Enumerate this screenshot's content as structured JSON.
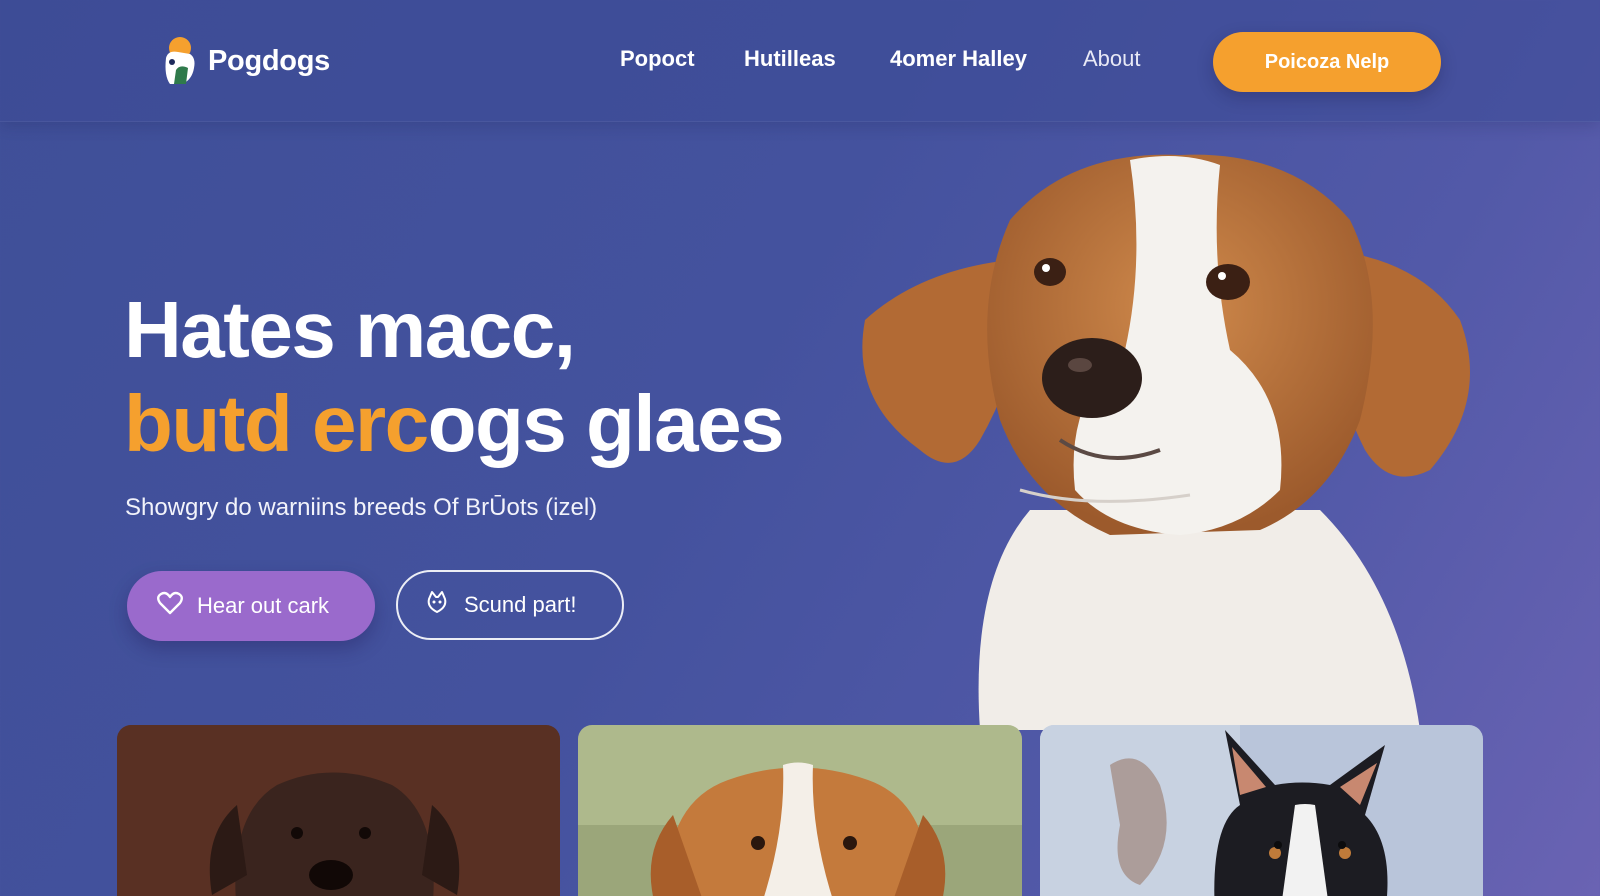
{
  "brand": {
    "name": "Pogdogs",
    "accent": "#f5a02e",
    "primary_button_color": "#9a6acc",
    "background": "#44529e"
  },
  "nav": {
    "items": [
      {
        "label": "Popoct"
      },
      {
        "label": "Hutilleas"
      },
      {
        "label": "4omer Halley"
      },
      {
        "label": "About"
      }
    ],
    "cta_label": "Poicoza Nelp"
  },
  "hero": {
    "headline_line1": "Hates macc,",
    "headline_line2_orange": "butd erc",
    "headline_line2_white": "ogs glaes",
    "subtitle": "Showgry do warniins breeds Of BrŪots (izel)",
    "primary_button": {
      "label": "Hear out cark",
      "icon": "heart-icon"
    },
    "secondary_button": {
      "label": "Scund part!",
      "icon": "dog-icon"
    }
  },
  "cards": [
    {
      "name": "dog-card-dark",
      "icon": "dog-photo"
    },
    {
      "name": "dog-card-spaniel",
      "icon": "dog-photo"
    },
    {
      "name": "dog-card-black",
      "icon": "dog-photo"
    }
  ]
}
